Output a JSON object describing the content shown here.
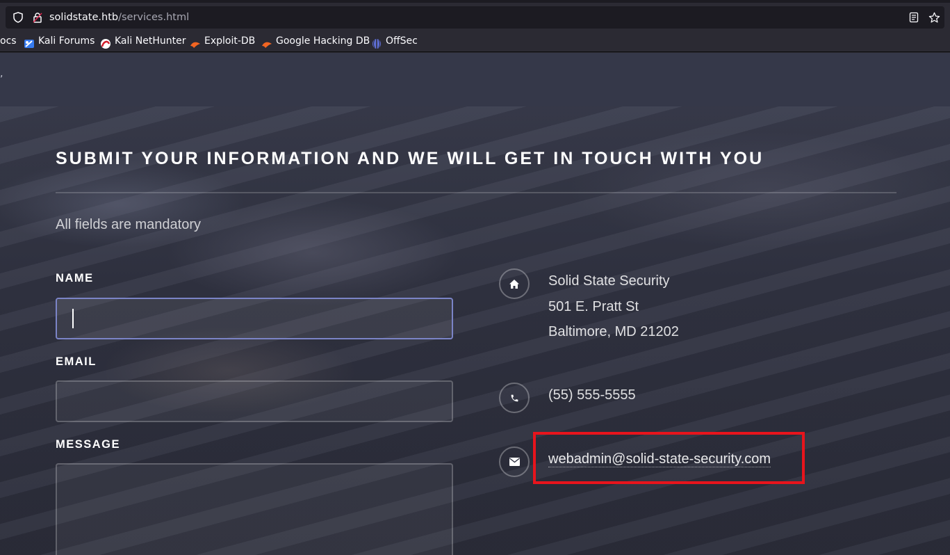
{
  "browser": {
    "url_host": "solidstate.htb",
    "url_path": "/services.html",
    "bookmarks": [
      {
        "label": "ocs",
        "icon": "none"
      },
      {
        "label": "Kali Forums",
        "icon": "kali-forums-icon"
      },
      {
        "label": "Kali NetHunter",
        "icon": "kali-nethunter-icon"
      },
      {
        "label": "Exploit-DB",
        "icon": "exploit-db-icon"
      },
      {
        "label": "Google Hacking DB",
        "icon": "ghdb-icon"
      },
      {
        "label": "OffSec",
        "icon": "offsec-icon"
      }
    ]
  },
  "contact": {
    "title": "SUBMIT YOUR INFORMATION AND WE WILL GET IN TOUCH WITH YOU",
    "mandatory_note": "All fields are mandatory",
    "form": {
      "name_label": "NAME",
      "name_value": "",
      "email_label": "EMAIL",
      "email_value": "",
      "message_label": "MESSAGE",
      "message_value": ""
    },
    "info": {
      "address_line1": "Solid State Security",
      "address_line2": "501 E. Pratt St",
      "address_line3": "Baltimore, MD 21202",
      "phone": "(55) 555-5555",
      "email": "webadmin@solid-state-security.com"
    }
  },
  "colors": {
    "highlight_box": "#e8141c",
    "focus_border": "#7b84c7",
    "header_bg": "#353849"
  }
}
